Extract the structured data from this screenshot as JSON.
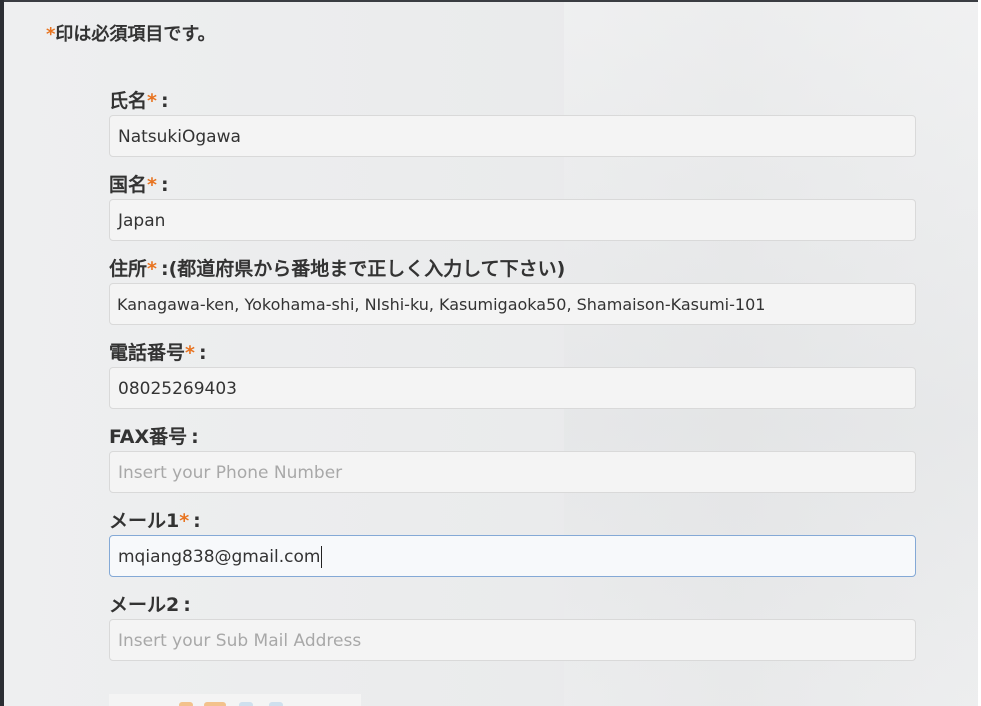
{
  "required_note": {
    "star": "*",
    "text": "印は必須項目です。"
  },
  "fields": [
    {
      "label": "氏名",
      "required": true,
      "note": "",
      "value": "NatsukiOgawa",
      "placeholder": ""
    },
    {
      "label": "国名",
      "required": true,
      "note": "",
      "value": "Japan",
      "placeholder": ""
    },
    {
      "label": "住所",
      "required": true,
      "note": "(都道府県から番地まで正しく入力して下さい)",
      "value": "Kanagawa-ken, Yokohama-shi, NIshi-ku, Kasumigaoka50, Shamaison-Kasumi-101",
      "placeholder": ""
    },
    {
      "label": "電話番号",
      "required": true,
      "note": "",
      "value": "08025269403",
      "placeholder": ""
    },
    {
      "label": "FAX番号",
      "required": false,
      "note": "",
      "value": "",
      "placeholder": "Insert your Phone Number"
    },
    {
      "label": "メール1",
      "required": true,
      "note": "",
      "value": "mqiang838@gmail.com",
      "placeholder": ""
    },
    {
      "label": "メール2",
      "required": false,
      "note": "",
      "value": "",
      "placeholder": "Insert your Sub Mail Address"
    }
  ],
  "colon": ":",
  "star": "*",
  "colors": {
    "required_star": "#e8731f",
    "text": "#333333",
    "placeholder": "#a8a8a8",
    "focus_border": "#84a9d6"
  }
}
